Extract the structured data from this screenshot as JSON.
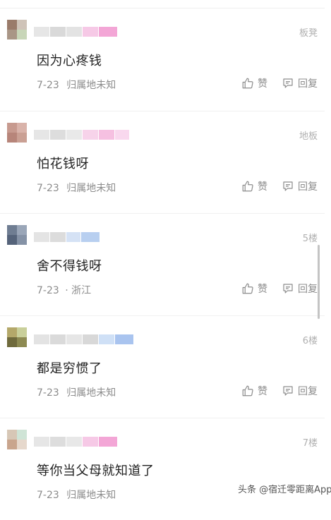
{
  "colors": {
    "meta": "#8c8c8c",
    "floor": "#b0b0b0",
    "text": "#222222"
  },
  "comments": [
    {
      "content": "因为心疼钱",
      "floor": "板凳",
      "date": "7-23",
      "location": "归属地未知",
      "like_label": "赞",
      "reply_label": "回复"
    },
    {
      "content": "怕花钱呀",
      "floor": "地板",
      "date": "7-23",
      "location": "归属地未知",
      "like_label": "赞",
      "reply_label": "回复"
    },
    {
      "content": "舍不得钱呀",
      "floor": "5楼",
      "date": "7-23",
      "location": "· 浙江",
      "like_label": "赞",
      "reply_label": "回复"
    },
    {
      "content": "都是穷惯了",
      "floor": "6楼",
      "date": "7-23",
      "location": "归属地未知",
      "like_label": "赞",
      "reply_label": "回复"
    },
    {
      "content": "等你当父母就知道了",
      "floor": "7楼",
      "date": "7-23",
      "location": "归属地未知",
      "like_label": "赞",
      "reply_label": "回复"
    }
  ],
  "watermark": "头条 @宿迁零距离App",
  "icons": {
    "like": "thumbs-up-icon",
    "reply": "comment-bubble-icon"
  }
}
